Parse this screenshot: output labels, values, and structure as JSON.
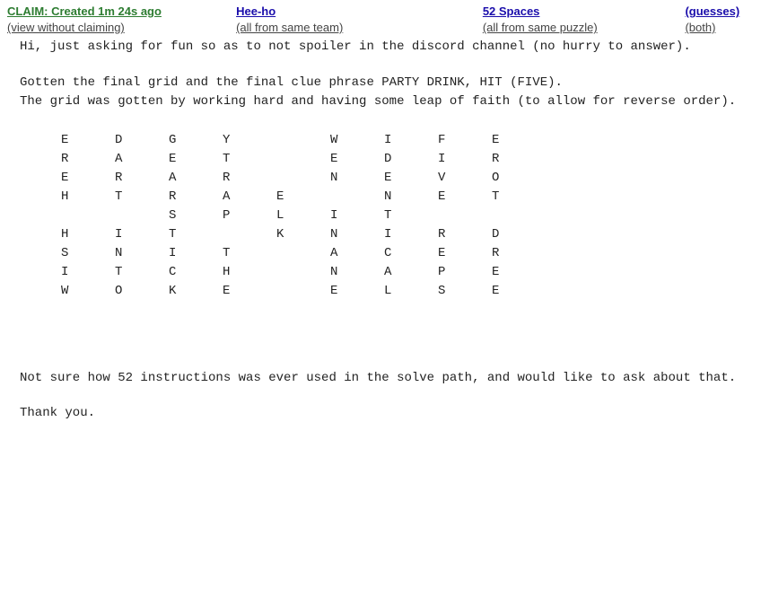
{
  "header": {
    "claim": "CLAIM: Created 1m 24s ago",
    "team": "Hee-ho",
    "puzzle": "52 Spaces",
    "guesses": "(guesses)"
  },
  "subheader": {
    "view": "(view without claiming)",
    "team_all": "(all from same team)",
    "puzzle_all": "(all from same puzzle)",
    "both": "(both)"
  },
  "para1": "Hi, just asking for fun so as to not spoiler in the discord channel (no hurry to answer).",
  "para2": "Gotten the final grid and the final clue phrase PARTY DRINK, HIT (FIVE).\nThe grid was gotten by working hard and having some leap of faith (to allow for reverse order).",
  "grid": [
    [
      "E",
      "D",
      "G",
      "Y",
      "",
      "W",
      "I",
      "F",
      "E"
    ],
    [
      "R",
      "A",
      "E",
      "T",
      "",
      "E",
      "D",
      "I",
      "R"
    ],
    [
      "E",
      "R",
      "A",
      "R",
      "",
      "N",
      "E",
      "V",
      "O"
    ],
    [
      "H",
      "T",
      "R",
      "A",
      "E",
      "",
      "N",
      "E",
      "T"
    ],
    [
      "",
      "",
      "S",
      "P",
      "L",
      "I",
      "T",
      "",
      ""
    ],
    [
      "H",
      "I",
      "T",
      "",
      "K",
      "N",
      "I",
      "R",
      "D"
    ],
    [
      "S",
      "N",
      "I",
      "T",
      "",
      "A",
      "C",
      "E",
      "R"
    ],
    [
      "I",
      "T",
      "C",
      "H",
      "",
      "N",
      "A",
      "P",
      "E"
    ],
    [
      "W",
      "O",
      "K",
      "E",
      "",
      "E",
      "L",
      "S",
      "E"
    ]
  ],
  "para3": "Not sure how 52 instructions was ever used in the solve path, and would like to ask about that.",
  "para4": "Thank you."
}
